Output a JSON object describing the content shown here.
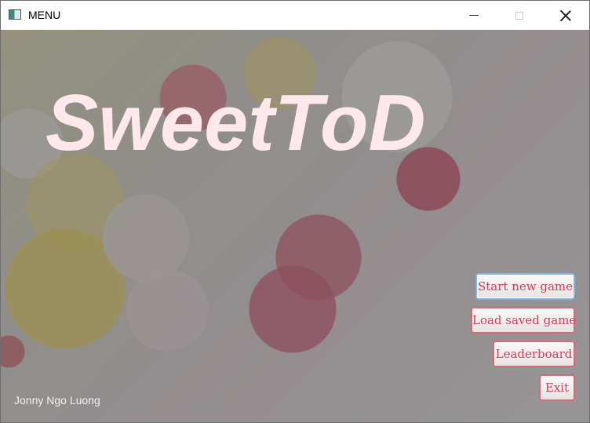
{
  "window": {
    "title": "MENU",
    "app_icon": "app-window-icon",
    "controls": {
      "minimize_icon": "minimize-icon",
      "maximize_icon": "maximize-icon",
      "close_icon": "close-icon"
    }
  },
  "game": {
    "logo": "SweetToD",
    "author": "Jonny Ngo Luong"
  },
  "menu": {
    "start_new_game": "Start new game",
    "load_saved_game": "Load saved game",
    "leaderboard": "Leaderboard",
    "exit": "Exit"
  },
  "colors": {
    "logo": "#ffe8eb",
    "button_text": "#d63b58",
    "button_border": "#dd6678",
    "focused_border": "#80b4e2"
  }
}
